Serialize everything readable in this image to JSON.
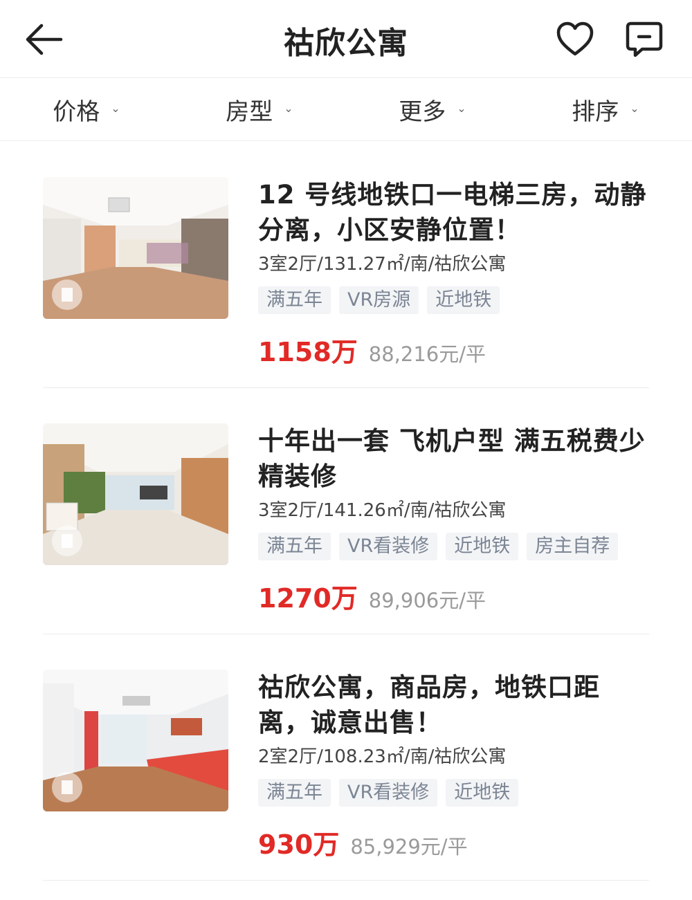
{
  "header": {
    "title": "祜欣公寓"
  },
  "filters": [
    {
      "label": "价格"
    },
    {
      "label": "房型"
    },
    {
      "label": "更多"
    },
    {
      "label": "排序"
    }
  ],
  "listings": [
    {
      "title": "12 号线地铁口一电梯三房，动静分离，小区安静位置！",
      "meta": "3室2厅/131.27㎡/南/祜欣公寓",
      "tags": [
        "满五年",
        "VR房源",
        "近地铁"
      ],
      "price": "1158万",
      "unit_price": "88,216元/平"
    },
    {
      "title": "十年出一套 飞机户型 满五税费少 精装修",
      "meta": "3室2厅/141.26㎡/南/祜欣公寓",
      "tags": [
        "满五年",
        "VR看装修",
        "近地铁",
        "房主自荐"
      ],
      "price": "1270万",
      "unit_price": "89,906元/平"
    },
    {
      "title": "祜欣公寓，商品房，地铁口距离，诚意出售！",
      "meta": "2室2厅/108.23㎡/南/祜欣公寓",
      "tags": [
        "满五年",
        "VR看装修",
        "近地铁"
      ],
      "price": "930万",
      "unit_price": "85,929元/平"
    }
  ],
  "colors": {
    "price": "#e12a26",
    "tag_bg": "#f3f4f6",
    "tag_text": "#7b8594"
  },
  "icons": [
    "back-arrow-icon",
    "heart-icon",
    "message-icon",
    "chevron-down-icon",
    "vr-icon"
  ]
}
